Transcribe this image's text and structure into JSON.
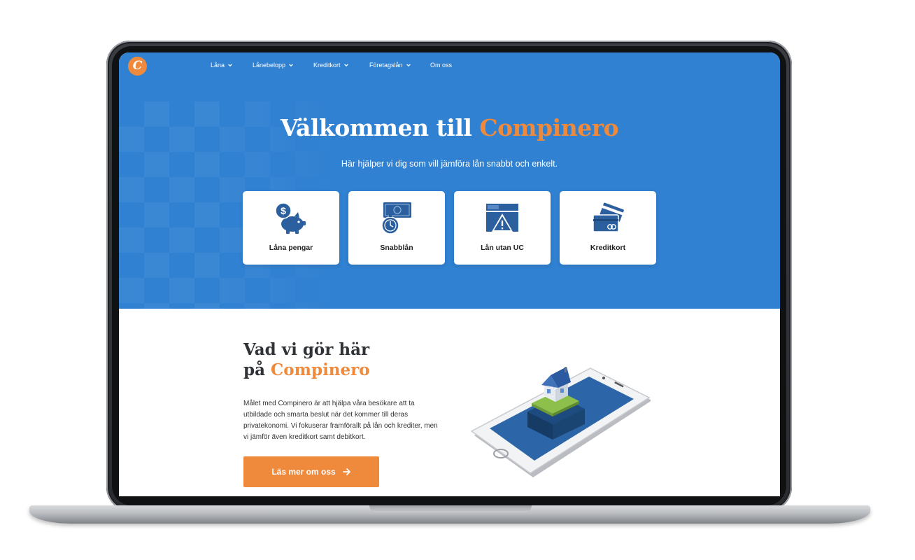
{
  "nav": {
    "logo_letter": "C",
    "items": [
      {
        "label": "Låna",
        "has_dropdown": true
      },
      {
        "label": "Lånebelopp",
        "has_dropdown": true
      },
      {
        "label": "Kreditkort",
        "has_dropdown": true
      },
      {
        "label": "Företagslån",
        "has_dropdown": true
      },
      {
        "label": "Om oss",
        "has_dropdown": false
      }
    ]
  },
  "hero": {
    "title_prefix": "Välkommen till ",
    "title_accent": "Compinero",
    "subtitle": "Här hjälper vi dig som vill jämföra lån snabbt och enkelt.",
    "cards": [
      {
        "label": "Låna pengar",
        "icon": "piggy-bank-icon"
      },
      {
        "label": "Snabblån",
        "icon": "stopwatch-money-icon"
      },
      {
        "label": "Lån utan UC",
        "icon": "warning-window-icon"
      },
      {
        "label": "Kreditkort",
        "icon": "credit-card-icon"
      }
    ]
  },
  "about": {
    "title_line1": "Vad vi gör här",
    "title_line2_prefix": "på ",
    "title_line2_accent": "Compinero",
    "text": "Målet med Compinero är att hjälpa våra besökare att ta utbildade och smarta beslut när det kommer till deras privatekonomi. Vi fokuserar framförallt på lån och krediter, men vi jämför även kreditkort samt debitkort.",
    "cta_label": "Läs mer om oss"
  },
  "colors": {
    "brand_blue": "#3081d2",
    "accent_orange": "#ef8a3c",
    "icon_blue": "#2b5f9e"
  }
}
